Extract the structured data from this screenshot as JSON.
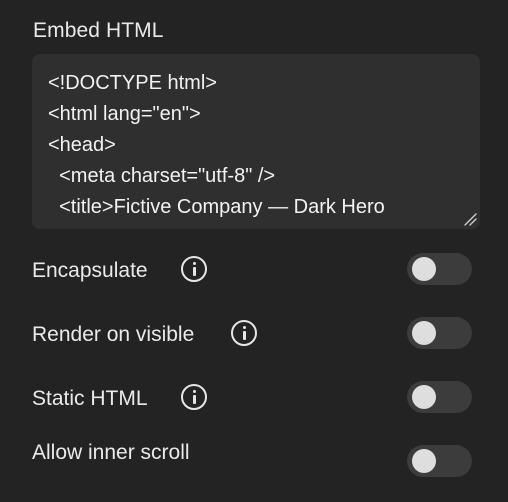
{
  "embed": {
    "title": "Embed HTML",
    "code": "<!DOCTYPE html>\n<html lang=\"en\">\n<head>\n  <meta charset=\"utf-8\" />\n  <title>Fictive Company — Dark Hero"
  },
  "options": [
    {
      "label": "Encapsulate",
      "has_info": true,
      "enabled": false
    },
    {
      "label": "Render on visible",
      "has_info": true,
      "enabled": false
    },
    {
      "label": "Static HTML",
      "has_info": true,
      "enabled": false
    },
    {
      "label": "Allow inner scroll",
      "has_info": false,
      "enabled": false
    }
  ],
  "icons": {
    "info": "info-circle-icon",
    "resize": "resize-handle-icon"
  },
  "colors": {
    "background": "#232323",
    "field_background": "#2f2f2f",
    "toggle_track_off": "#3c3c3c",
    "toggle_knob": "#dedede",
    "text": "#eaeaea"
  }
}
